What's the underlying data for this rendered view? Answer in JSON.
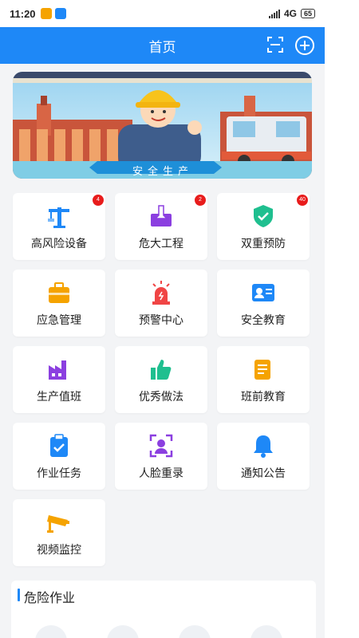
{
  "status_bar": {
    "time": "11:20",
    "network": "4G",
    "battery": "65"
  },
  "header": {
    "title": "首页"
  },
  "banner": {
    "caption": "安全生产"
  },
  "tiles": [
    {
      "label": "高风险设备",
      "badge": "4",
      "icon": "tower-crane-icon",
      "color": "#1e88f7"
    },
    {
      "label": "危大工程",
      "badge": "2",
      "icon": "shovel-icon",
      "color": "#8b3fe0"
    },
    {
      "label": "双重预防",
      "badge": "40",
      "icon": "shield-check-icon",
      "color": "#1fbf8f"
    },
    {
      "label": "应急管理",
      "icon": "toolbox-icon",
      "color": "#f5a300"
    },
    {
      "label": "预警中心",
      "icon": "alarm-light-icon",
      "color": "#f04545"
    },
    {
      "label": "安全教育",
      "icon": "id-card-icon",
      "color": "#1e88f7"
    },
    {
      "label": "生产值班",
      "icon": "factory-icon",
      "color": "#8b3fe0"
    },
    {
      "label": "优秀做法",
      "icon": "thumbs-up-icon",
      "color": "#1fbf8f"
    },
    {
      "label": "班前教育",
      "icon": "notepad-icon",
      "color": "#f5a300"
    },
    {
      "label": "作业任务",
      "icon": "clipboard-check-icon",
      "color": "#1e88f7"
    },
    {
      "label": "人脸重录",
      "icon": "face-scan-icon",
      "color": "#8b3fe0"
    },
    {
      "label": "通知公告",
      "icon": "bell-icon",
      "color": "#1e88f7"
    },
    {
      "label": "视频监控",
      "icon": "cctv-camera-icon",
      "color": "#f5a300"
    }
  ],
  "section": {
    "title": "危险作业"
  }
}
